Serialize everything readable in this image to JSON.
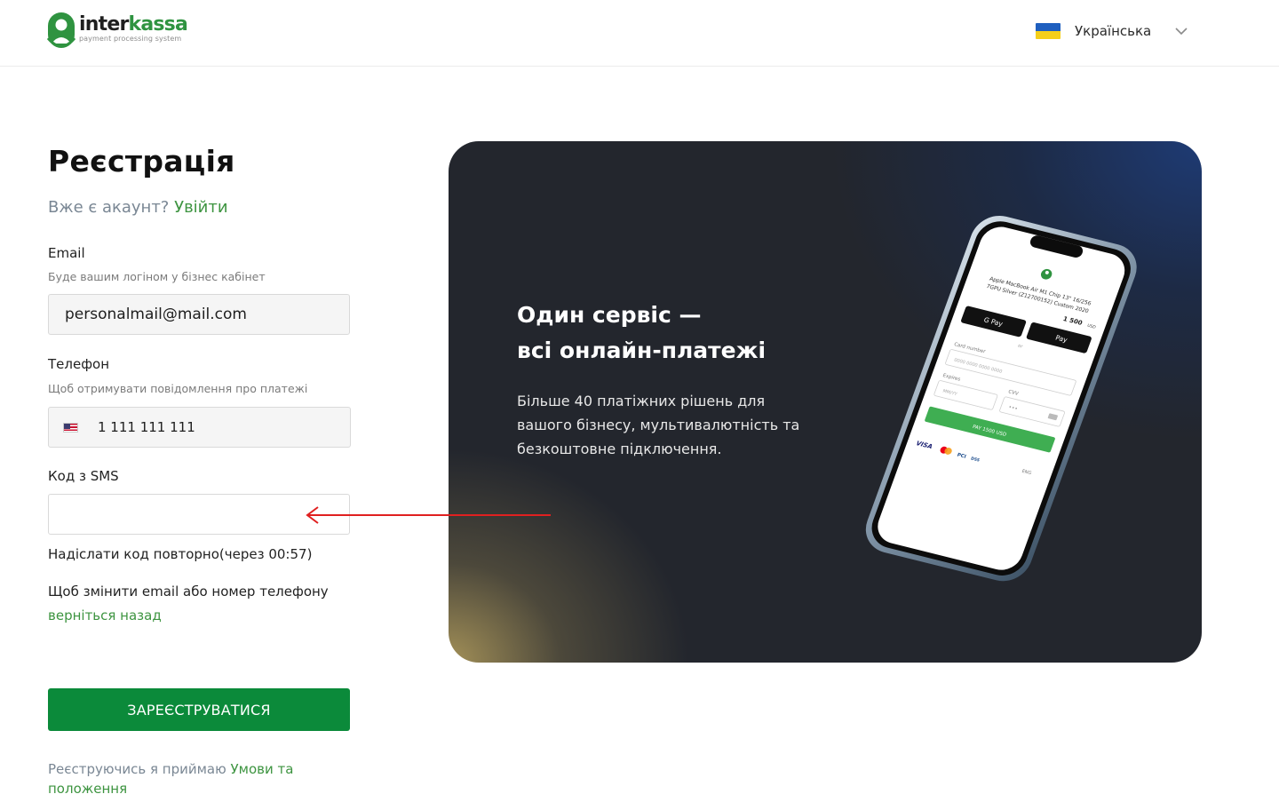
{
  "header": {
    "logo": {
      "word_left": "inter",
      "word_right": "kassa",
      "tagline": "payment processing system",
      "accent": "#2f9340"
    },
    "language": {
      "label": "Українська",
      "flag": "ukraine-flag"
    }
  },
  "form": {
    "title": "Реєстрація",
    "have_account": "Вже є акаунт?",
    "login_link": "Увійти",
    "email": {
      "label": "Email",
      "hint": "Буде вашим логіном у бізнес кабінет",
      "value": "personalmail@mail.com"
    },
    "phone": {
      "label": "Телефон",
      "hint": "Щоб отримувати повідомлення про платежі",
      "value": "1 111 111 111",
      "flag": "usa-flag"
    },
    "sms": {
      "label": "Код з SMS",
      "value": ""
    },
    "resend": "Надіслати код повторно(через 00:57)",
    "change_text": "Щоб змінити email або номер телефону",
    "go_back": "верніться назад",
    "submit": "ЗАРЕЄСТРУВАТИСЯ",
    "terms_prefix": "Реєструючись я приймаю",
    "terms_link": "Умови та положення",
    "accent": "#0b8a3a"
  },
  "promo": {
    "heading_line1": "Один сервіс —",
    "heading_line2": "всі онлайн-платежі",
    "paragraph": "Більше 40 платіжних рішень для вашого бізнесу, мультивалютність та безкоштовне підключення.",
    "phone_screen": {
      "product_line1": "Apple MacBook Air M1 Chip 13\" 16/256",
      "product_line2": "7GPU Silver (Z12700152) Custom 2020",
      "amount": "1 500",
      "currency": "USD",
      "gpay": "G Pay",
      "applepay": "Pay",
      "or": "or",
      "card_label": "Card number",
      "card_placeholder": "0000 0000 0000 0000",
      "expires_label": "Expires",
      "expires_placeholder": "MM/YY",
      "cvv_label": "CVV",
      "cvv_placeholder": "•••",
      "pay_button": "PAY 1500 USD",
      "brand_visa": "VISA",
      "brand_pci": "PCI",
      "brand_dss": "DSS",
      "lang": "ENG"
    }
  },
  "annotation": {
    "arrow_color": "#e02020"
  }
}
